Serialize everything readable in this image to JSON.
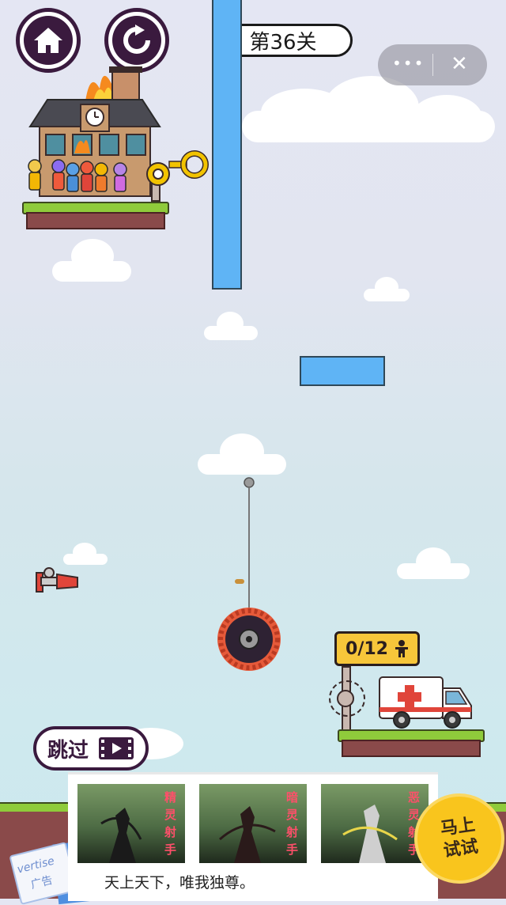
{
  "level": {
    "label": "第36关"
  },
  "menu": {
    "more_glyph": "•••",
    "close_glyph": "✕"
  },
  "counter": {
    "text": "0/12"
  },
  "skip": {
    "label": "跳过"
  },
  "ad": {
    "cards": [
      {
        "title": "精灵射手",
        "chars": [
          "精",
          "灵",
          "射",
          "手"
        ]
      },
      {
        "title": "暗灵射手",
        "chars": [
          "暗",
          "灵",
          "射",
          "手"
        ]
      },
      {
        "title": "恶灵射手",
        "chars": [
          "恶",
          "灵",
          "射",
          "手"
        ]
      }
    ],
    "caption": "天上天下，唯我独尊。",
    "cta_line1": "马上",
    "cta_line2": "试试",
    "stamp_line1": "vertise",
    "stamp_line2": "广告"
  },
  "icons": {
    "home": "home-icon",
    "restart": "restart-icon",
    "person": "person-icon",
    "video": "video-icon"
  },
  "colors": {
    "accent_dark": "#3a1a3e",
    "blue_bar": "#5fb4f5",
    "grass": "#8fcb3b",
    "soil": "#8a4a4a",
    "counter_bg": "#f7c63a",
    "cta": "#f9c51d"
  }
}
